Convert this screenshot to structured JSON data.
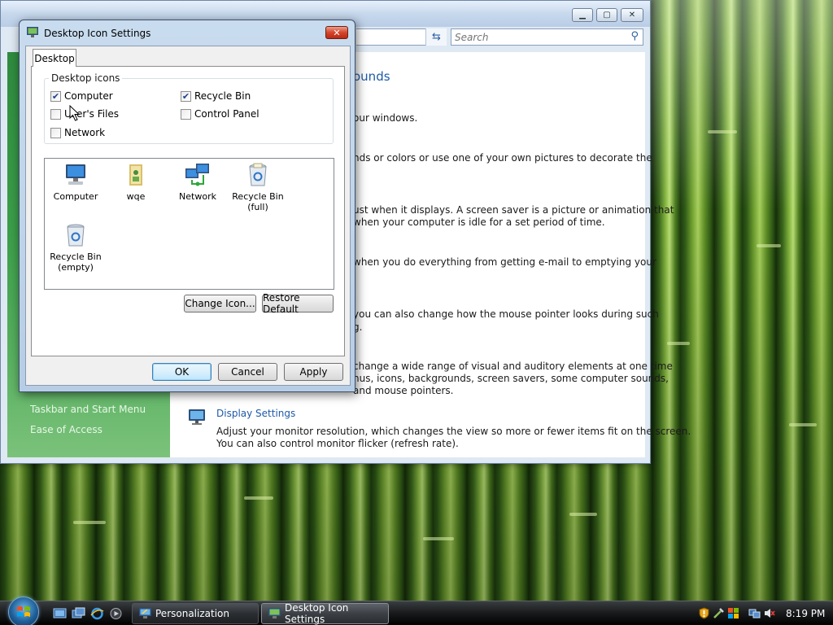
{
  "background_window": {
    "search_placeholder": "Search",
    "heading_fragment": "ounds",
    "content_lines": [
      "our windows.",
      "nds or colors or use one of your own pictures to decorate the",
      "ust when it displays. A screen saver is a picture or animation that",
      "when your computer is idle for a set period of time.",
      "when you do everything from getting e-mail to emptying your",
      "you can also change how the mouse pointer looks during such",
      "g.",
      "change a wide range of visual and auditory elements at one time",
      "nus, icons, backgrounds, screen savers, some computer sounds,",
      "and mouse pointers."
    ],
    "left_links": [
      "Taskbar and Start Menu",
      "Ease of Access"
    ],
    "display_settings": {
      "title": "Display Settings",
      "line1": "Adjust your monitor resolution, which changes the view so more or fewer items fit on the screen.",
      "line2": "You can also control monitor flicker (refresh rate)."
    }
  },
  "dialog": {
    "title": "Desktop Icon Settings",
    "close_label": "✕",
    "tab_label": "Desktop",
    "group_label": "Desktop icons",
    "checkboxes": [
      {
        "label": "Computer",
        "checked": true
      },
      {
        "label": "Recycle Bin",
        "checked": true
      },
      {
        "label": "User's Files",
        "checked": false
      },
      {
        "label": "Control Panel",
        "checked": false
      },
      {
        "label": "Network",
        "checked": false
      }
    ],
    "icons": [
      {
        "label": "Computer",
        "icon": "computer-icon"
      },
      {
        "label": "wqe",
        "icon": "user-folder-icon"
      },
      {
        "label": "Network",
        "icon": "network-icon"
      },
      {
        "label": "Recycle Bin\n(full)",
        "icon": "recycle-bin-full-icon"
      },
      {
        "label": "Recycle Bin\n(empty)",
        "icon": "recycle-bin-empty-icon"
      }
    ],
    "change_icon_label": "Change Icon...",
    "restore_default_label": "Restore Default",
    "ok_label": "OK",
    "cancel_label": "Cancel",
    "apply_label": "Apply"
  },
  "taskbar": {
    "buttons": [
      {
        "label": "Personalization",
        "icon": "personalization-icon"
      },
      {
        "label": "Desktop Icon Settings",
        "icon": "desktop-icon-settings-icon"
      }
    ],
    "clock": "8:19 PM"
  },
  "colors": {
    "link_blue": "#1e5aa8",
    "left_pane_green": "#3c9e4a",
    "close_red": "#d5462c"
  }
}
